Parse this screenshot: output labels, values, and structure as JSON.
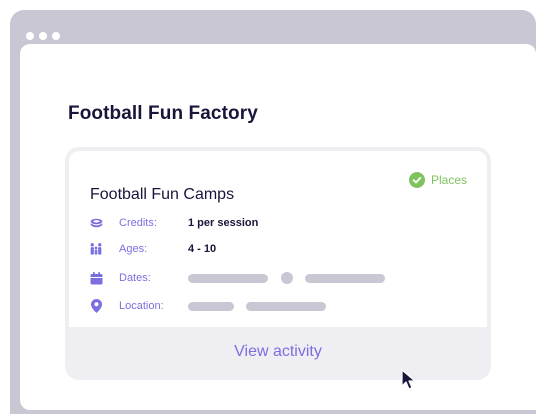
{
  "window": {
    "frame_color": "#c9c7d4"
  },
  "page": {
    "title": "Football Fun Factory"
  },
  "card": {
    "title": "Football Fun Camps",
    "badge": {
      "label": "Places",
      "icon": "check-circle-icon",
      "color": "#7fc35e"
    },
    "details": [
      {
        "icon": "credits-icon",
        "label": "Credits:",
        "value": "1 per session"
      },
      {
        "icon": "ages-icon",
        "label": "Ages:",
        "value": "4 - 10"
      },
      {
        "icon": "calendar-icon",
        "label": "Dates:",
        "value": ""
      },
      {
        "icon": "location-pin-icon",
        "label": "Location:",
        "value": ""
      }
    ],
    "action_label": "View activity",
    "accent_color": "#7b6fe0"
  }
}
